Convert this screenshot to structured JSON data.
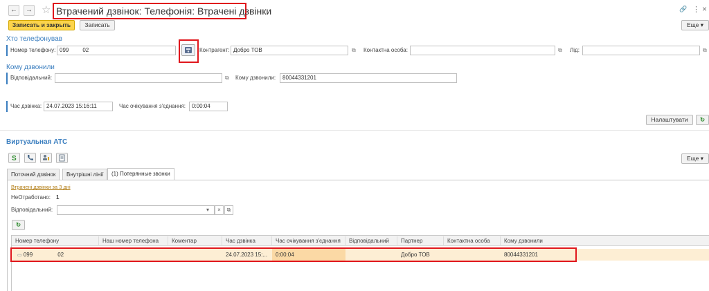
{
  "window": {
    "title": "Втрачений дзвінок: Телефонія: Втрачені дзвінки",
    "back": "←",
    "forward": "→",
    "star": "☆",
    "link_icon": "🔗",
    "menu_icon": "⋮",
    "close_icon": "×"
  },
  "toolbar": {
    "save_close": "Записать и закрыть",
    "save": "Записать",
    "more": "Еще ▾"
  },
  "caller": {
    "section": "Хто телефонував",
    "phone_label": "Номер телефону:",
    "phone_value": "099",
    "phone_value_tail": "02",
    "contragent_label": "Контрагент:",
    "contragent_value": "Добро ТОВ",
    "contact_label": "Контактна особа:",
    "contact_value": "",
    "lead_label": "Лід:",
    "lead_value": ""
  },
  "callee": {
    "section": "Кому дзвонили",
    "responsible_label": "Відповідальний:",
    "responsible_value": "",
    "called_label": "Кому дзвонили:",
    "called_value": "80044331201"
  },
  "timing": {
    "call_time_label": "Час дзвінка:",
    "call_time_value": "24.07.2023 15:16:11",
    "wait_label": "Час очікування з'єднання:",
    "wait_value": "0:00:04"
  },
  "configure_button": "Налаштувати",
  "refresh_icon": "↻",
  "ats": {
    "section": "Виртуальная АТС",
    "more": "Еще ▾",
    "tabs": [
      "Поточний дзвінок",
      "Внутрішні лінії",
      "(1) Потерянные звонки"
    ],
    "missed_link": "Втрачені дзвінки за 3 дні",
    "unprocessed_label": "НеОтработано:",
    "unprocessed_value": "1",
    "responsible_label": "Відповідальний:",
    "responsible_value": "",
    "dropdown_icon": "▾",
    "clear_icon": "×",
    "columns": [
      "Номер телефону",
      "Наш номер телефона",
      "Коментар",
      "Час дзвінка",
      "Час очікування з'єднання",
      "Відповідальний",
      "Партнер",
      "Контактна особа",
      "Кому дзвонили"
    ],
    "row": {
      "phone": "099",
      "phone_tail": "02",
      "our_phone": "",
      "comment": "",
      "call_time": "24.07.2023 15:...",
      "wait": "0:00:04",
      "responsible": "",
      "partner": "Добро ТОВ",
      "contact": "",
      "called": "80044331201"
    }
  },
  "colors": {
    "accent": "#3a7ebf",
    "primary_button": "#fcd44b",
    "highlight": "#e0161c",
    "row_bg": "#fdeed4",
    "cell_selected": "#fbd9a5"
  }
}
